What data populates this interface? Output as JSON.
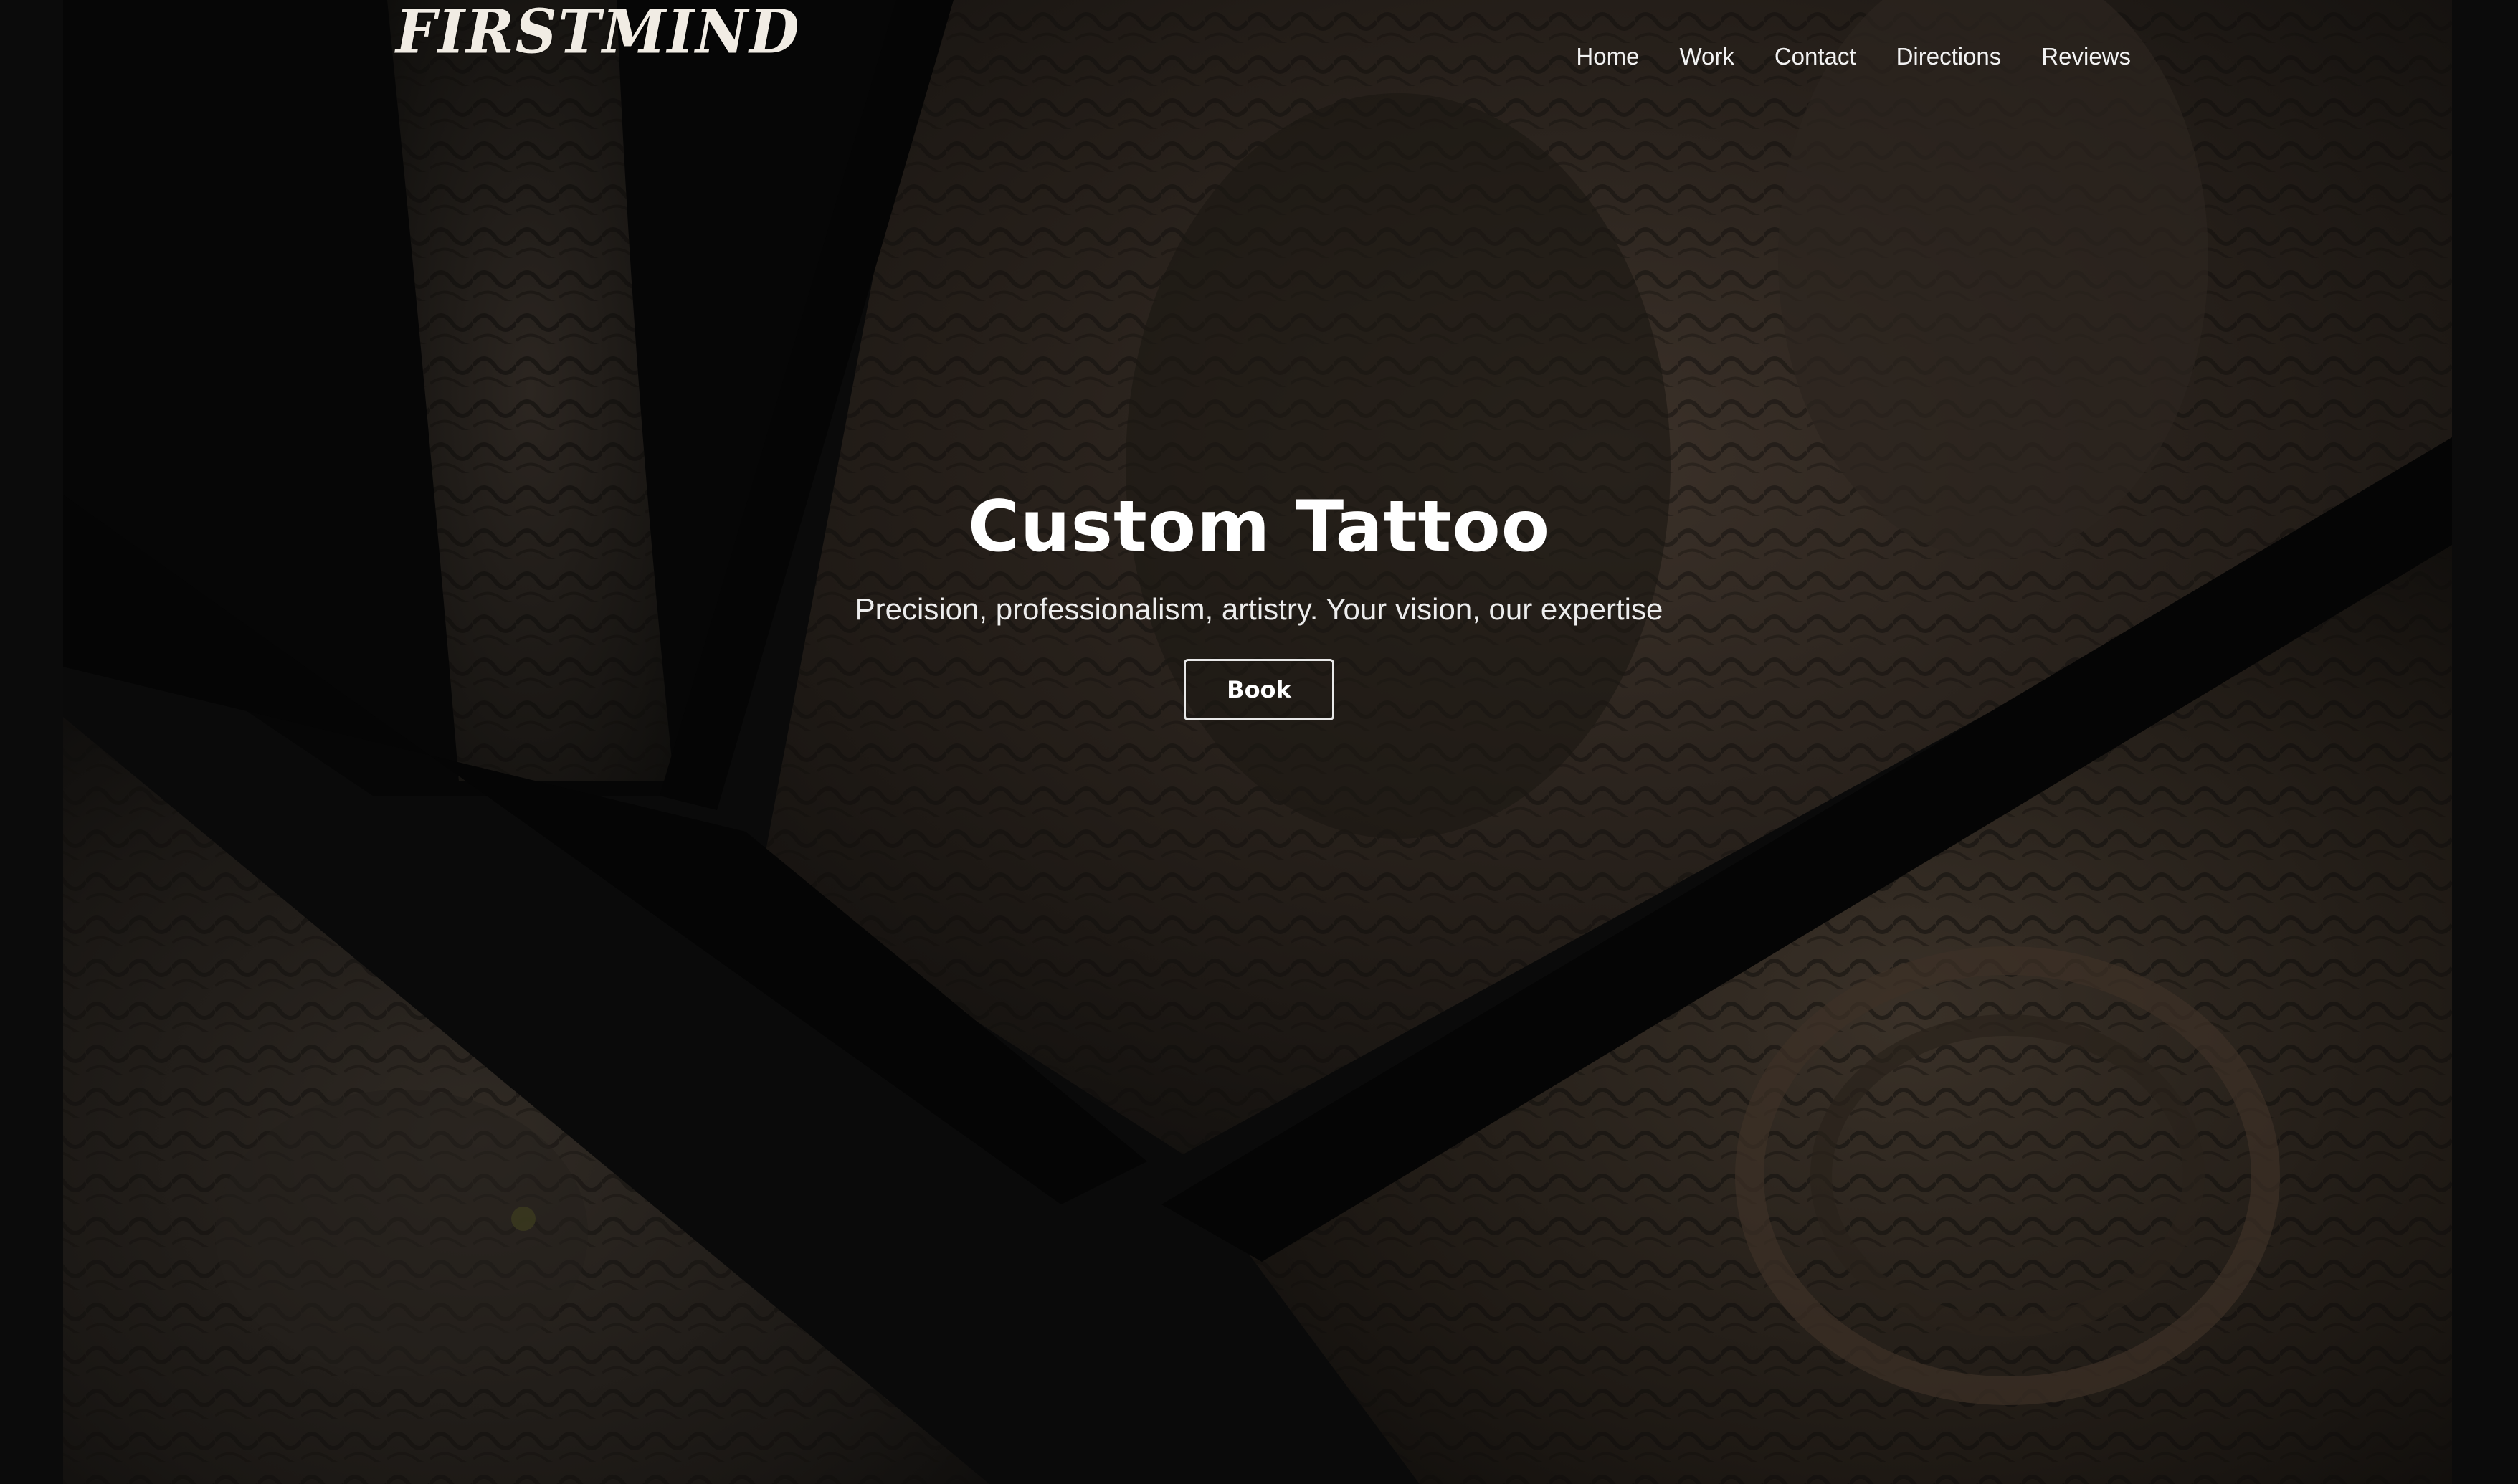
{
  "brand": {
    "logo_text": "FIRSTMIND"
  },
  "nav": {
    "items": [
      {
        "label": "Home"
      },
      {
        "label": "Work"
      },
      {
        "label": "Contact"
      },
      {
        "label": "Directions"
      },
      {
        "label": "Reviews"
      }
    ]
  },
  "hero": {
    "title": "Custom Tattoo",
    "subtitle": "Precision, professionalism, artistry. Your vision, our expertise",
    "cta_label": "Book"
  },
  "background": {
    "description_icon": "tattoo-photo-collage",
    "colors": {
      "page": "#0b0b0b",
      "panel_dark": "#1a1714",
      "skin_shadow": "#3a2e24",
      "ink": "#141210"
    }
  }
}
